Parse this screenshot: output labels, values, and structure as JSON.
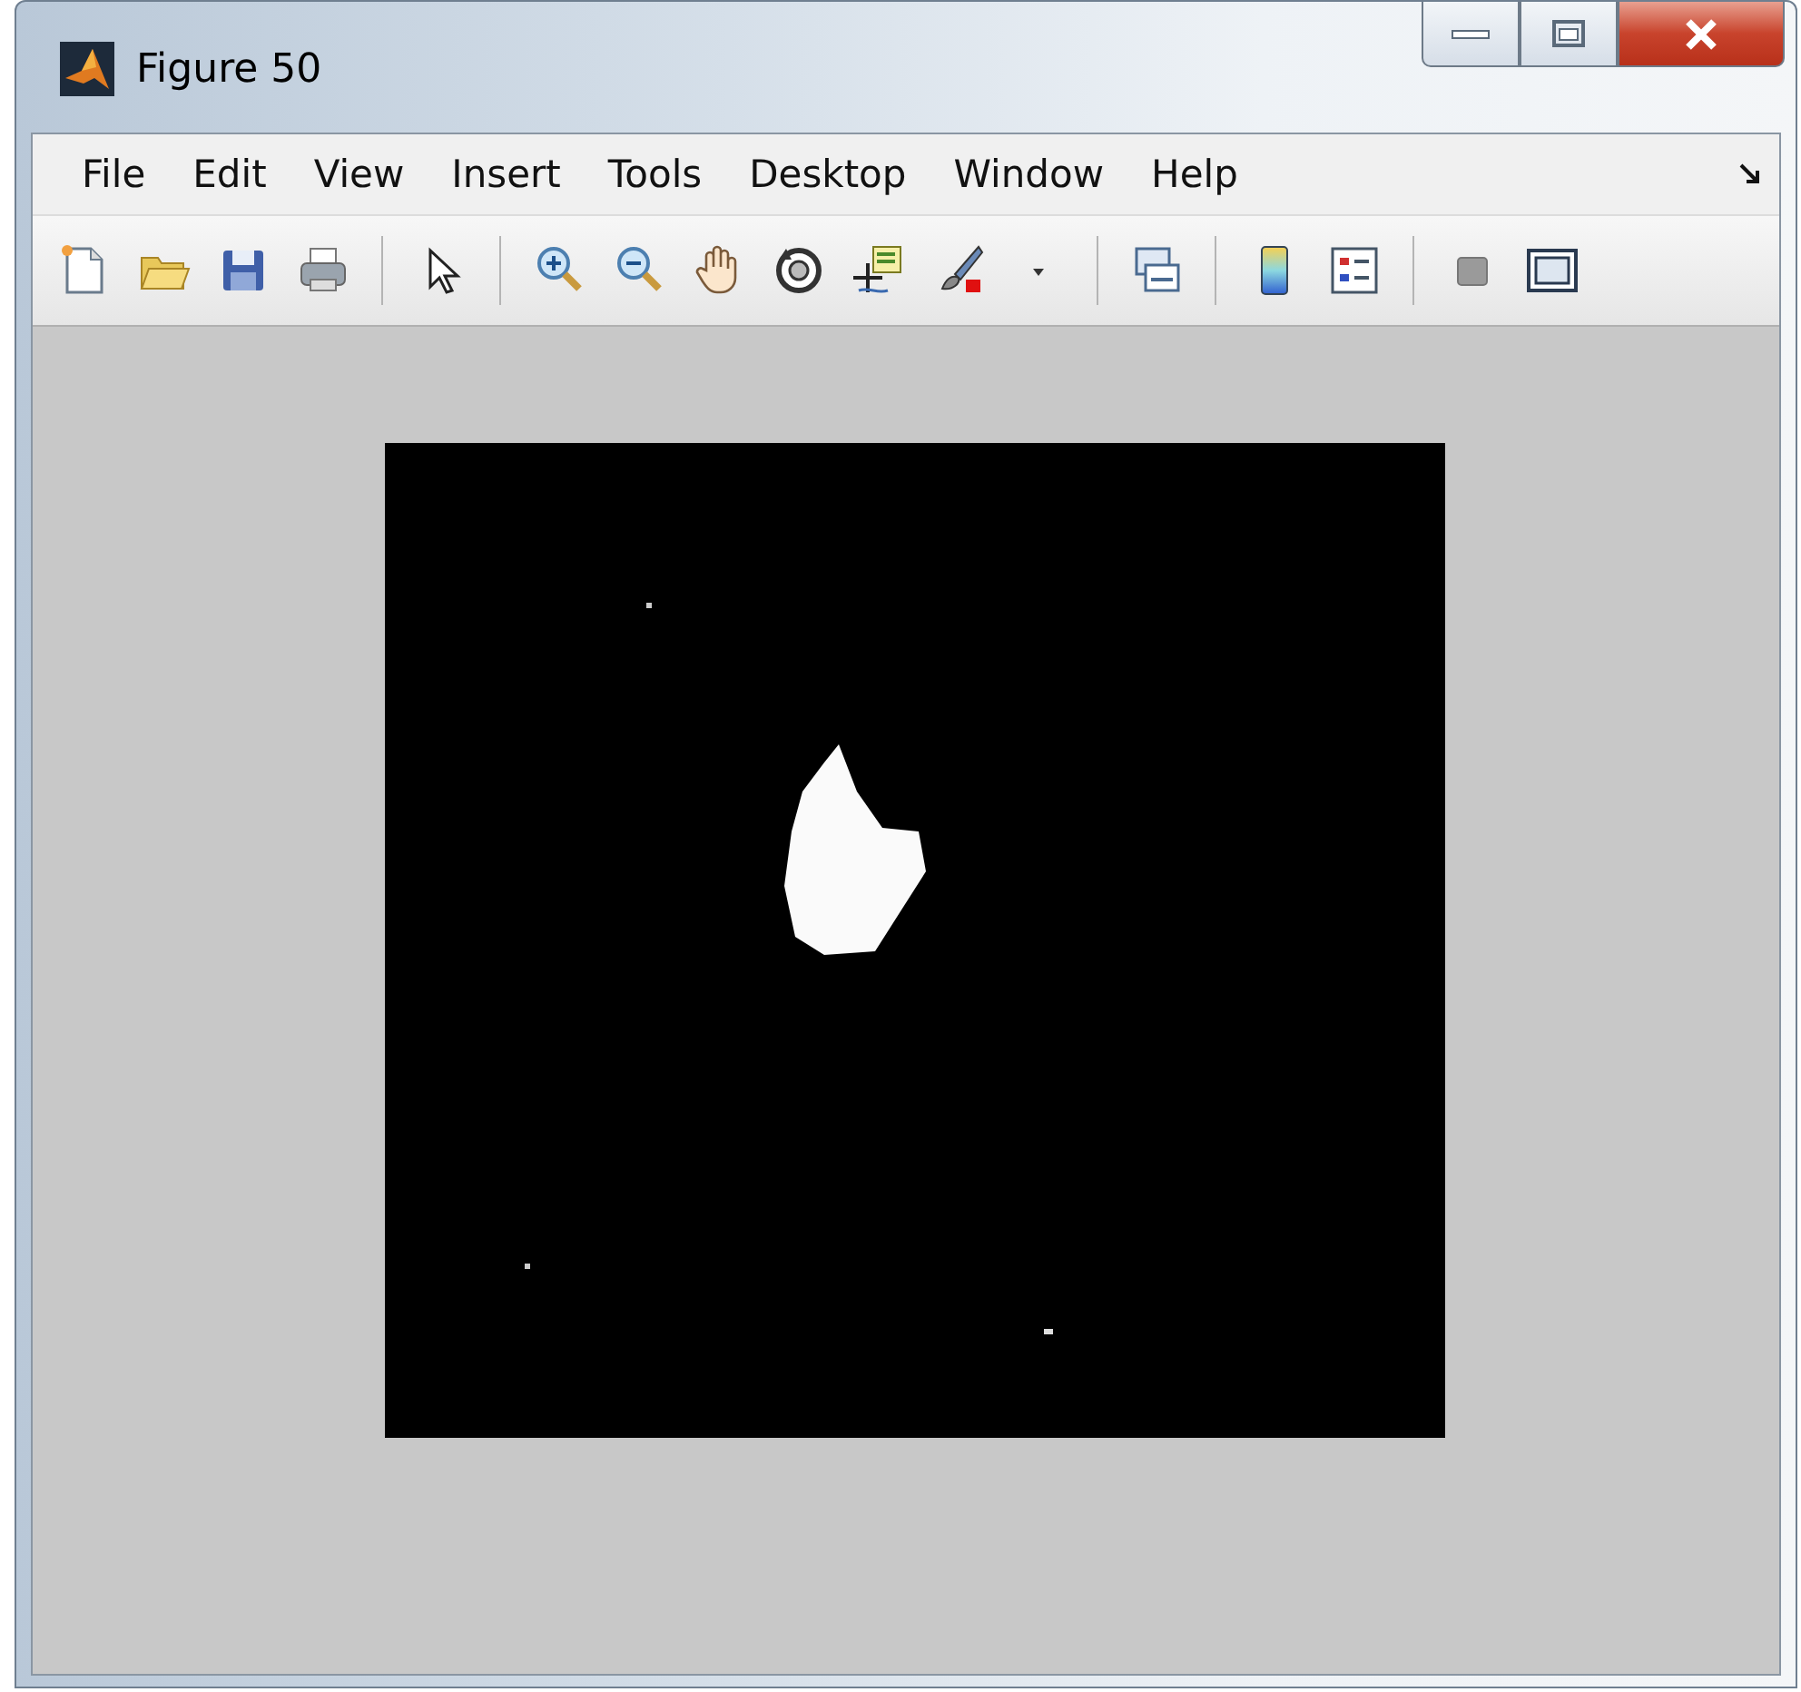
{
  "window": {
    "title": "Figure 50"
  },
  "menu": [
    {
      "label": "File"
    },
    {
      "label": "Edit"
    },
    {
      "label": "View"
    },
    {
      "label": "Insert"
    },
    {
      "label": "Tools"
    },
    {
      "label": "Desktop"
    },
    {
      "label": "Window"
    },
    {
      "label": "Help"
    }
  ]
}
